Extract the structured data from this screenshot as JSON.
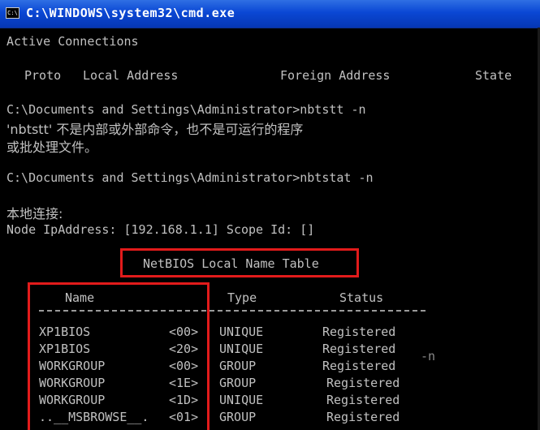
{
  "window": {
    "title": "C:\\WINDOWS\\system32\\cmd.exe",
    "icon_label": "C:\\"
  },
  "console": {
    "active_connections": "Active Connections",
    "headers": [
      "Proto",
      "Local Address",
      "Foreign Address",
      "State"
    ],
    "cmd1": "C:\\Documents and Settings\\Administrator>nbtstt -n",
    "error_line1": "'nbtstt' 不是内部或外部命令，也不是可运行的程序",
    "error_line2": "或批处理文件。",
    "cmd2": "C:\\Documents and Settings\\Administrator>nbtstat -n",
    "local_connection": "本地连接:",
    "node_ip": "Node IpAddress: [192.168.1.1] Scope Id: []",
    "table_title": "NetBIOS Local Name Table",
    "table_headers": {
      "name": "Name",
      "type": "Type",
      "status": "Status"
    },
    "rows": [
      {
        "name": "XP1BIOS",
        "code": "<00>",
        "type": "UNIQUE",
        "status": "Registered"
      },
      {
        "name": "XP1BIOS",
        "code": "<20>",
        "type": "UNIQUE",
        "status": "Registered"
      },
      {
        "name": "WORKGROUP",
        "code": "<00>",
        "type": "GROUP",
        "status": "Registered"
      },
      {
        "name": "WORKGROUP",
        "code": "<1E>",
        "type": "GROUP",
        "status": "Registered"
      },
      {
        "name": "WORKGROUP",
        "code": "<1D>",
        "type": "UNIQUE",
        "status": "Registered"
      },
      {
        "name": "..__MSBROWSE__.",
        "code": "<01>",
        "type": "GROUP",
        "status": "Registered"
      }
    ],
    "stray_text": "-n"
  },
  "colors": {
    "titlebar": "#0a47d4",
    "console_bg": "#000000",
    "console_text": "#c0c0c0",
    "highlight": "#e21b1b"
  }
}
